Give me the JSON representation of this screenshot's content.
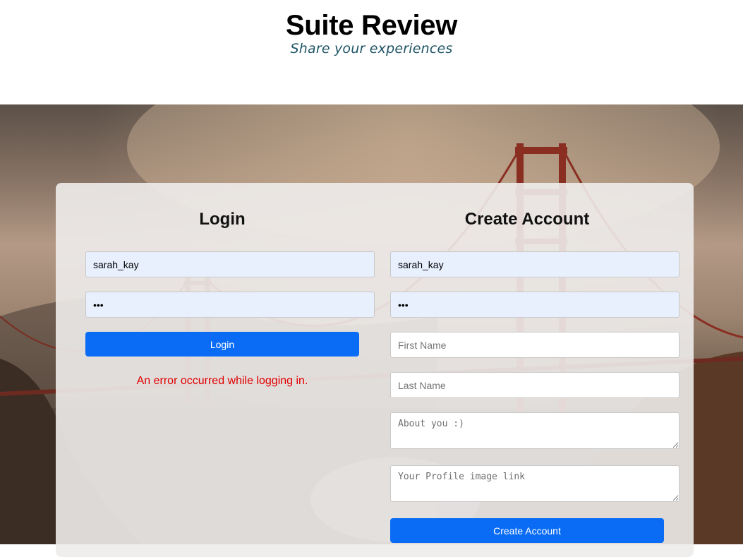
{
  "header": {
    "title": "Suite Review",
    "tagline": "Share your experiences"
  },
  "login": {
    "heading": "Login",
    "username_value": "sarah_kay",
    "password_value": "abc",
    "button_label": "Login",
    "error_message": "An error occurred while logging in."
  },
  "create_account": {
    "heading": "Create Account",
    "username_value": "sarah_kay",
    "password_value": "abc",
    "first_name_placeholder": "First Name",
    "last_name_placeholder": "Last Name",
    "about_placeholder": "About you :)",
    "profile_image_placeholder": "Your Profile image link",
    "button_label": "Create Account"
  },
  "colors": {
    "primary_button": "#0a6cf5",
    "error_text": "#e00000",
    "autofill_background": "#e8f0fe",
    "tagline_text": "#1f5566"
  }
}
